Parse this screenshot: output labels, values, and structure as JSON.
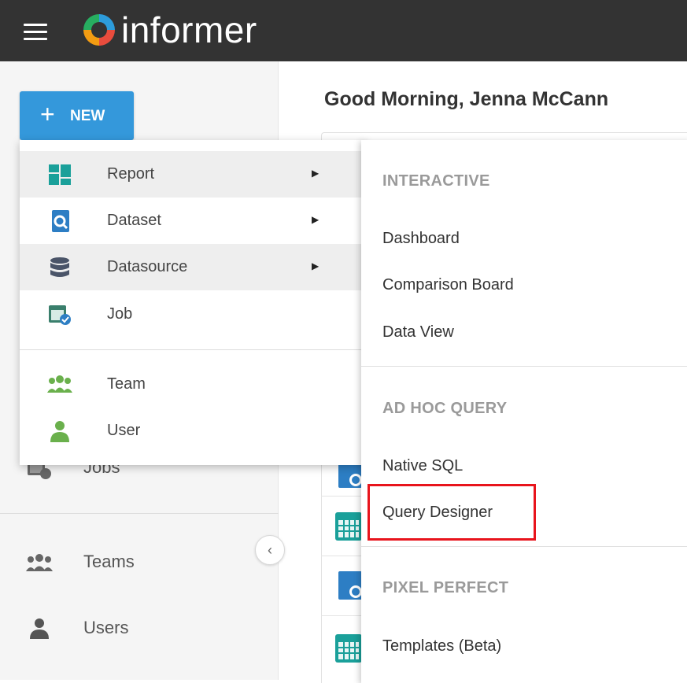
{
  "header": {
    "logo_text": "informer"
  },
  "new_button": {
    "label": "NEW",
    "plus": "+"
  },
  "greeting": "Good Morning, Jenna McCann",
  "sidebar": {
    "items": [
      {
        "label": "Jobs",
        "icon": "jobs-icon"
      },
      {
        "label": "Teams",
        "icon": "teams-icon"
      },
      {
        "label": "Users",
        "icon": "users-icon"
      }
    ],
    "collapse_glyph": "‹"
  },
  "new_menu": {
    "items": [
      {
        "label": "Report",
        "icon": "report-icon",
        "has_submenu": true
      },
      {
        "label": "Dataset",
        "icon": "dataset-icon",
        "has_submenu": true
      },
      {
        "label": "Datasource",
        "icon": "datasource-icon",
        "has_submenu": true
      },
      {
        "label": "Job",
        "icon": "job-icon",
        "has_submenu": false
      },
      {
        "label": "Team",
        "icon": "team-icon",
        "has_submenu": false
      },
      {
        "label": "User",
        "icon": "user-icon",
        "has_submenu": false
      }
    ],
    "arrow": "▶"
  },
  "report_submenu": {
    "sections": [
      {
        "header": "INTERACTIVE",
        "items": [
          "Dashboard",
          "Comparison Board",
          "Data View"
        ]
      },
      {
        "header": "AD HOC QUERY",
        "items": [
          "Native SQL",
          "Query Designer"
        ]
      },
      {
        "header": "PIXEL PERFECT",
        "items": [
          "Templates (Beta)"
        ]
      }
    ]
  },
  "colors": {
    "topbar": "#333333",
    "accent_blue": "#3498db",
    "highlight_red": "#e8141c",
    "icon_teal": "#27ae60",
    "icon_green": "#6ab04c"
  }
}
